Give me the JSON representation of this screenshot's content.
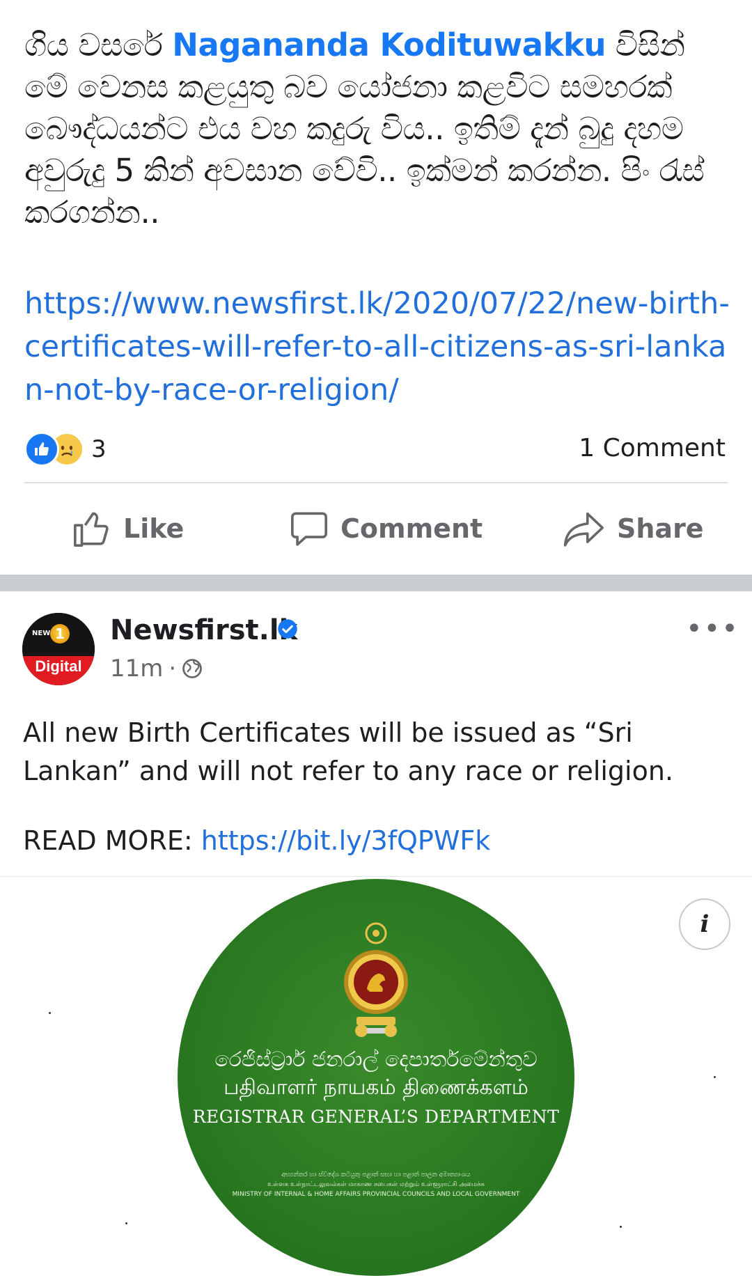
{
  "post1": {
    "text_before": "ගිය වසරේ ",
    "mention": "Nagananda Kodituwakku",
    "text_after": " විසින් මේ වෙනස කළයුතු බව යෝජනා කළවිට සමහරක් බෞද්ධයන්ට එය වහ කදුරු විය.. ඉතිම් දැන් බුදු දහම අවුරුදු 5 කින් අවසාන වේවි.. ඉක්මන් කරන්න. පිං රැස් කරගන්න..",
    "link": "https://www.newsfirst.lk/2020/07/22/new-birth-certificates-will-refer-to-all-citizens-as-sri-lankan-not-by-race-or-religion/",
    "reaction_count": "3",
    "comment_count": "1 Comment",
    "reaction_icons": [
      "like-icon",
      "sad-icon"
    ]
  },
  "actions": {
    "like": "Like",
    "comment": "Comment",
    "share": "Share"
  },
  "post2": {
    "page_name": "Newsfirst.lk",
    "time": "11m",
    "separator": "·",
    "avatar_top_text": "NEWS",
    "avatar_number": "1",
    "avatar_label": "Digital",
    "text": "All new Birth Certificates will be issued as “Sri Lankan” and will not refer to any race or religion.",
    "read_more_label": "READ MORE: ",
    "read_more_link": "https://bit.ly/3fQPWFk",
    "more_menu": "•••"
  },
  "image": {
    "sinhala_title": "රෙජිස්ට්‍රාර් ජනරාල් දෙපාර්තමේන්තුව",
    "tamil_title": "பதிவாளர் நாயகம் திணைக்களம்",
    "english_title": "REGISTRAR GENERAL’S DEPARTMENT",
    "ministry_line1": "අභ්‍යන්තර හා ස්වදේශ කටයුතු පළාත් සභා හා පළාත් පාලන අමාත්‍යාංශය",
    "ministry_line2": "உள்ளக உள்நாட்டலுவல்கள் மாகாண சபைகள் மற்றும் உள்ளூராட்சி அமைச்சு",
    "ministry_line3": "MINISTRY OF INTERNAL & HOME AFFAIRS PROVINCIAL COUNCILS AND LOCAL GOVERNMENT",
    "info_label": "i",
    "colors": {
      "circle": "#2b7a22",
      "link": "#216fdb",
      "mention": "#1877f2"
    }
  }
}
